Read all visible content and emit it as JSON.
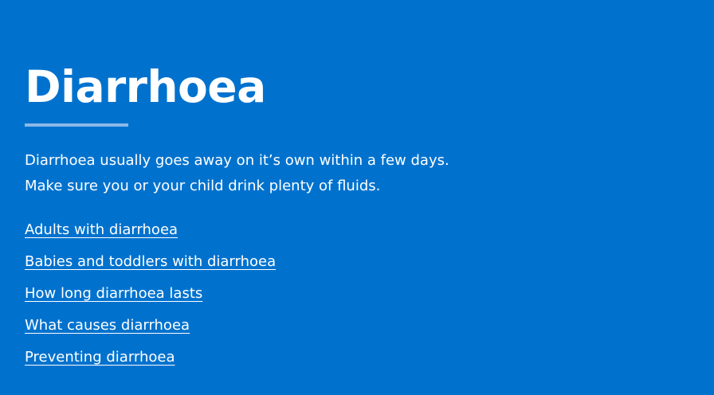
{
  "colors": {
    "background": "#0072CE",
    "text": "#FFFFFF",
    "rule": "#8BB8E8"
  },
  "header": {
    "title": "Diarrhoea"
  },
  "intro": {
    "line1": "Diarrhoea usually goes away on it’s own within a few days.",
    "line2": "Make sure you or your child drink plenty of fluids."
  },
  "links": [
    {
      "label": "Adults with diarrhoea"
    },
    {
      "label": "Babies and toddlers with diarrhoea"
    },
    {
      "label": "How long diarrhoea lasts"
    },
    {
      "label": "What causes diarrhoea"
    },
    {
      "label": "Preventing diarrhoea"
    }
  ]
}
